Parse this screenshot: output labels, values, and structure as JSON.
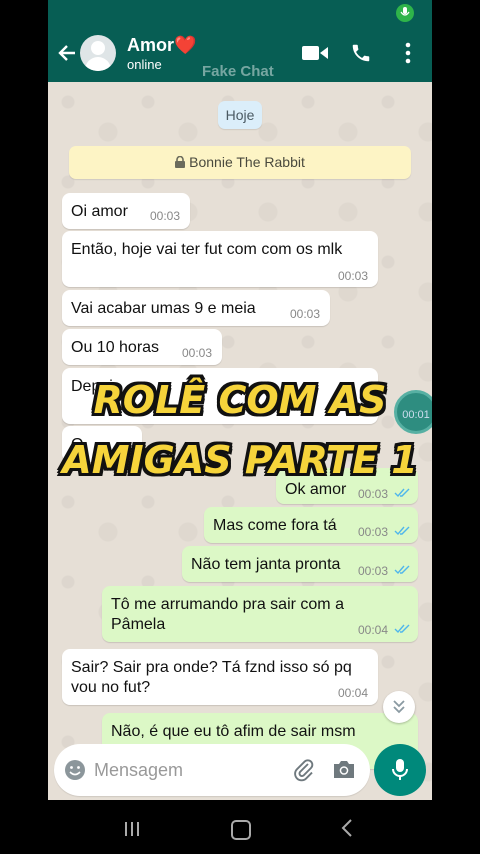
{
  "header": {
    "contact_name": "Amor❤️",
    "status": "online",
    "watermark": "Fake Chat"
  },
  "chat": {
    "date_chip": "Hoje",
    "encryption_notice": "Bonnie The Rabbit",
    "overlay_title_line1": "ROLÊ COM AS",
    "overlay_title_line2": "AMIGAS PARTE 1",
    "floating_time": "00:01",
    "messages": [
      {
        "dir": "in",
        "text": "Oi amor",
        "time": "00:03"
      },
      {
        "dir": "in",
        "text": "Então, hoje vai ter fut com com os mlk",
        "time": "00:03"
      },
      {
        "dir": "in",
        "text": "Vai acabar umas 9 e meia",
        "time": "00:03"
      },
      {
        "dir": "in",
        "text": "Ou 10 horas",
        "time": "00:03"
      },
      {
        "dir": "in",
        "text": "Depoi",
        "time": ""
      },
      {
        "dir": "in",
        "text": "O",
        "time": ""
      },
      {
        "dir": "out",
        "text": "Ok amor",
        "time": "00:03"
      },
      {
        "dir": "out",
        "text": "Mas come fora tá",
        "time": "00:03"
      },
      {
        "dir": "out",
        "text": "Não tem janta pronta",
        "time": "00:03"
      },
      {
        "dir": "out",
        "text": "Tô me arrumando pra sair com a Pâmela",
        "time": "00:04"
      },
      {
        "dir": "in",
        "text": "Sair? Sair pra onde? Tá fznd isso só pq vou no fut?",
        "time": "00:04"
      },
      {
        "dir": "out",
        "text": "Não, é que eu tô afim de sair msm",
        "time": ""
      }
    ]
  },
  "composer": {
    "placeholder": "Mensagem"
  },
  "colors": {
    "header": "#075e54",
    "outgoing_bubble": "#dcf8c6",
    "incoming_bubble": "#ffffff",
    "accent": "#00897b",
    "overlay_text": "#f6d43b"
  }
}
